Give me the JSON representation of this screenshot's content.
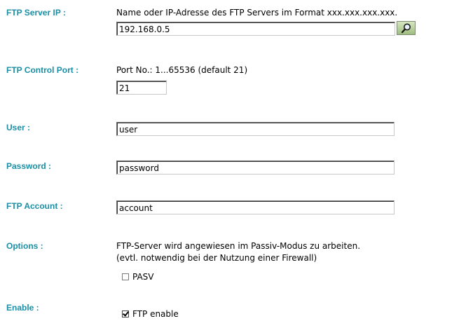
{
  "ftp_server_ip": {
    "label": "FTP Server IP :",
    "hint": "Name oder IP-Adresse des FTP Servers im Format xxx.xxx.xxx.xxx.",
    "value": "192.168.0.5"
  },
  "ftp_control_port": {
    "label": "FTP Control Port :",
    "hint": "Port No.: 1...65536 (default 21)",
    "value": "21"
  },
  "user": {
    "label": "User :",
    "value": "user"
  },
  "password": {
    "label": "Password :",
    "value": "password"
  },
  "ftp_account": {
    "label": "FTP Account :",
    "value": "account"
  },
  "options": {
    "label": "Options :",
    "hint_line1": "FTP-Server wird angewiesen im Passiv-Modus zu arbeiten.",
    "hint_line2": "(evtl. notwendig bei der Nutzung einer Firewall)",
    "pasv_label": "PASV",
    "pasv_checked": false
  },
  "enable": {
    "label": "Enable :",
    "ftp_enable_label": "FTP enable",
    "ftp_enable_checked": true
  },
  "icons": {
    "search_button": "magnifier-icon"
  },
  "colors": {
    "label": "#1a8fa6"
  }
}
